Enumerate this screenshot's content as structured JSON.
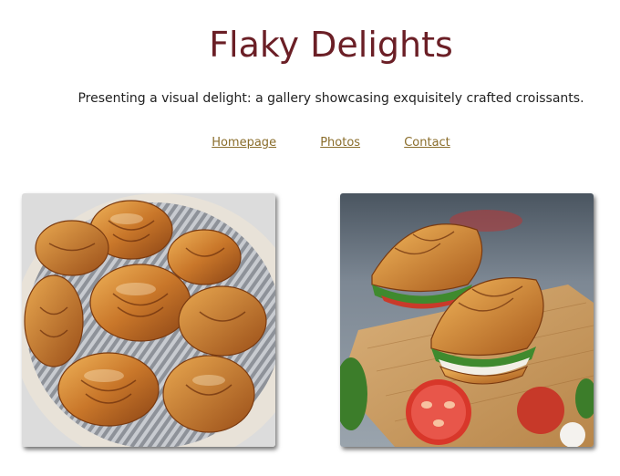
{
  "header": {
    "title": "Flaky Delights",
    "tagline": "Presenting a visual delight: a gallery showcasing exquisitely crafted croissants."
  },
  "nav": {
    "items": [
      {
        "label": "Homepage"
      },
      {
        "label": "Photos"
      },
      {
        "label": "Contact"
      }
    ]
  },
  "colors": {
    "title": "#6b1f26",
    "link": "#8a6d2b",
    "text": "#222222"
  },
  "gallery": {
    "items": [
      {
        "image": "croissant-basket-photo"
      },
      {
        "image": "croissant-sandwich-photo"
      }
    ]
  }
}
